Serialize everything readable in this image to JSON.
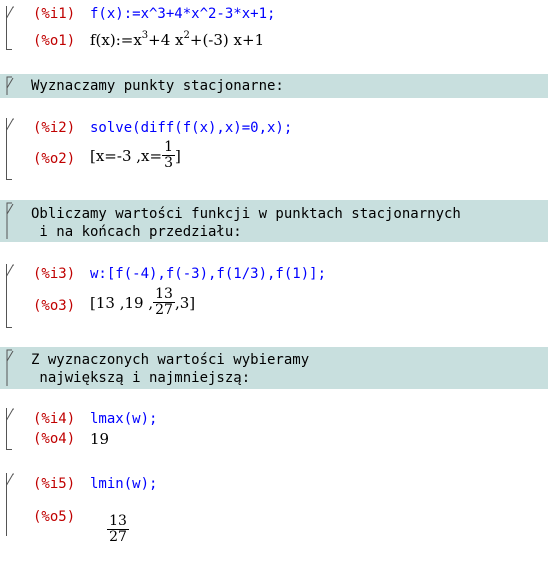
{
  "cells": [
    {
      "in_label": "(%i1)",
      "in_text": "f(x):=x^3+4*x^2-3*x+1;",
      "out_label": "(%o1)",
      "out_parts": [
        "f(x):=x",
        "3",
        "+4 x",
        "2",
        "+(-3) x+1"
      ]
    },
    {
      "text": "Wyznaczamy punkty stacjonarne:"
    },
    {
      "in_label": "(%i2)",
      "in_text": "solve(diff(f(x),x)=0,x);",
      "out_label": "(%o2)",
      "out_parts": [
        "[x=-3 ,x=",
        "1",
        "3",
        "]"
      ]
    },
    {
      "text": "Obliczamy wartości funkcji w punktach stacjonarnych\n i na końcach przedziału:"
    },
    {
      "in_label": "(%i3)",
      "in_text": "w:[f(-4),f(-3),f(1/3),f(1)];",
      "out_label": "(%o3)",
      "out_parts": [
        "[13 ,19 ,",
        "13",
        "27",
        ",3]"
      ]
    },
    {
      "text": "Z wyznaczonych wartości wybieramy\n największą i najmniejszą:"
    },
    {
      "in_label": "(%i4)",
      "in_text": "lmax(w);",
      "out_label": "(%o4)",
      "out_parts": [
        "19"
      ]
    },
    {
      "in_label": "(%i5)",
      "in_text": "lmin(w);",
      "out_label": "(%o5)",
      "out_parts": [
        "13",
        "27"
      ]
    }
  ]
}
